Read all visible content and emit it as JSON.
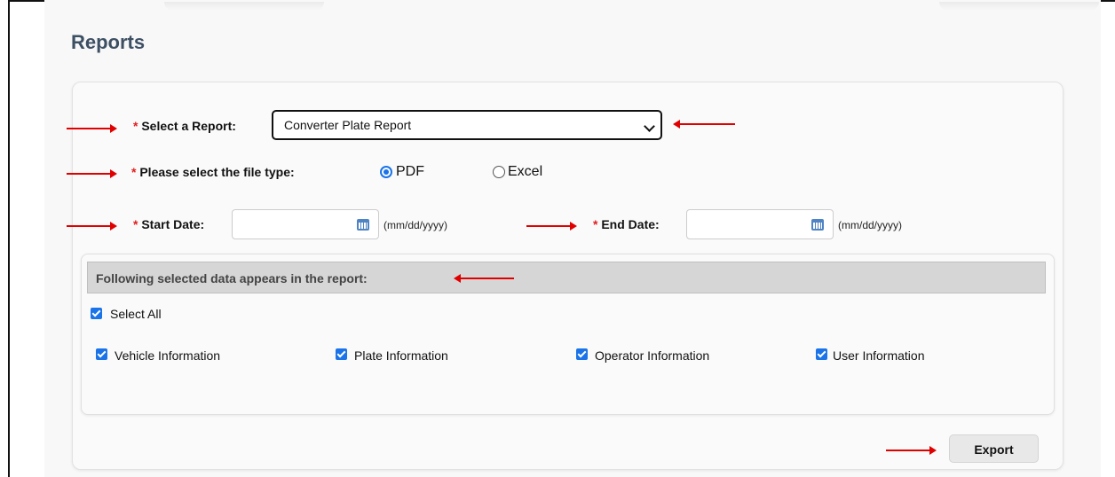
{
  "page": {
    "title": "Reports"
  },
  "form": {
    "report_label": "Select a Report:",
    "report_selected": "Converter Plate Report",
    "filetype_label": "Please select the file type:",
    "filetype_options": [
      "PDF",
      "Excel"
    ],
    "filetype_selected": "PDF",
    "start_label": "Start Date:",
    "start_value": "",
    "start_hint": "(mm/dd/yyyy)",
    "end_label": "End Date:",
    "end_value": "",
    "end_hint": "(mm/dd/yyyy)",
    "required_mark": "*"
  },
  "data_section": {
    "title": "Following selected data appears in the report:",
    "select_all": "Select All",
    "items": [
      "Vehicle Information",
      "Plate Information",
      "Operator Information",
      "User Information"
    ]
  },
  "actions": {
    "export_label": "Export"
  },
  "colors": {
    "accent": "#1a73e8",
    "annotation": "#e00000",
    "title": "#3d4f63"
  },
  "icons": {
    "calendar": "calendar-icon",
    "dropdown": "chevron-down-icon"
  }
}
